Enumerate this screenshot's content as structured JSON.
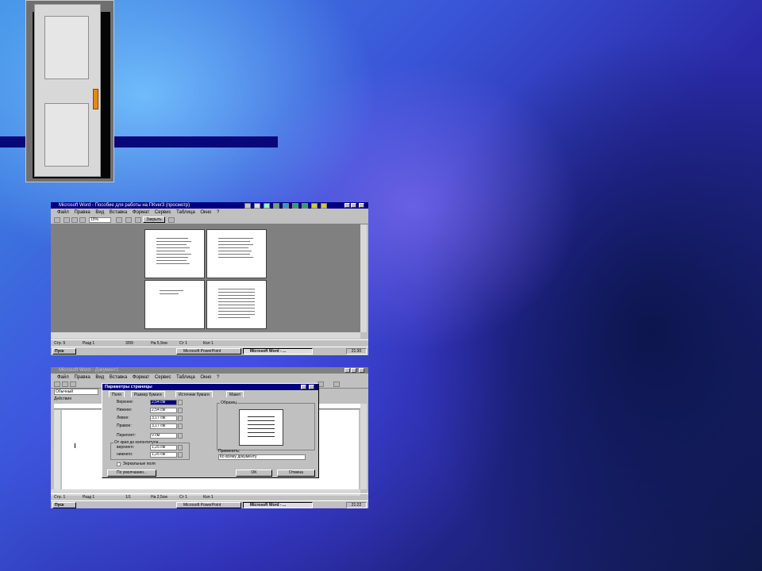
{
  "preview_window": {
    "title": "Microsoft Word - Пособие для работы на ПКver3 (просмотр)",
    "menu": [
      "Файл",
      "Правка",
      "Вид",
      "Вставка",
      "Формат",
      "Сервис",
      "Таблица",
      "Окно",
      "?"
    ],
    "zoom": "15%",
    "close_label": "Закрыть",
    "status": {
      "page": "Стр. 5",
      "section": "Разд 1",
      "pages": "3/99",
      "position": "На 5,9см",
      "line": "Ст 1",
      "col": "Кол 1"
    },
    "taskbar": {
      "start": "Пуск",
      "task1": "Microsoft PowerPoint",
      "task2": "Microsoft Word - ...",
      "clock": "21:30"
    }
  },
  "page_setup_window": {
    "title": "Microsoft Word - Документ1",
    "menu": [
      "Файл",
      "Правка",
      "Вид",
      "Вставка",
      "Формат",
      "Сервис",
      "Таблица",
      "Окно",
      "?"
    ],
    "style_box": "Обычный",
    "actions_label": "Действия",
    "status": {
      "page": "Стр. 1",
      "section": "Разд 1",
      "pages": "1/1",
      "position": "На 2,5см",
      "line": "Ст 1",
      "col": "Кол 1"
    },
    "taskbar": {
      "start": "Пуск",
      "task1": "Microsoft PowerPoint",
      "task2": "Microsoft Word - ...",
      "clock": "21:22"
    },
    "dialog": {
      "title": "Параметры страницы",
      "tabs": [
        "Поля",
        "Размер бумаги",
        "Источник бумаги",
        "Макет"
      ],
      "fields": [
        {
          "label": "Верхнее:",
          "value": "2,54 см"
        },
        {
          "label": "Нижнее:",
          "value": "2,54 см"
        },
        {
          "label": "Левое:",
          "value": "3,17 см"
        },
        {
          "label": "Правое:",
          "value": "3,17 см"
        },
        {
          "label": "Переплет:",
          "value": "0 см"
        }
      ],
      "edge_group": "От края до колонтитула",
      "edge_fields": [
        {
          "label": "верхнего:",
          "value": "1,25 см"
        },
        {
          "label": "нижнего:",
          "value": "1,25 см"
        }
      ],
      "mirror_label": "Зеркальные поля",
      "sample_label": "Образец",
      "apply_label": "Применить:",
      "apply_value": "Ко всему документу",
      "default_button": "По умолчанию...",
      "ok_button": "OK",
      "cancel_button": "Отмена"
    }
  }
}
